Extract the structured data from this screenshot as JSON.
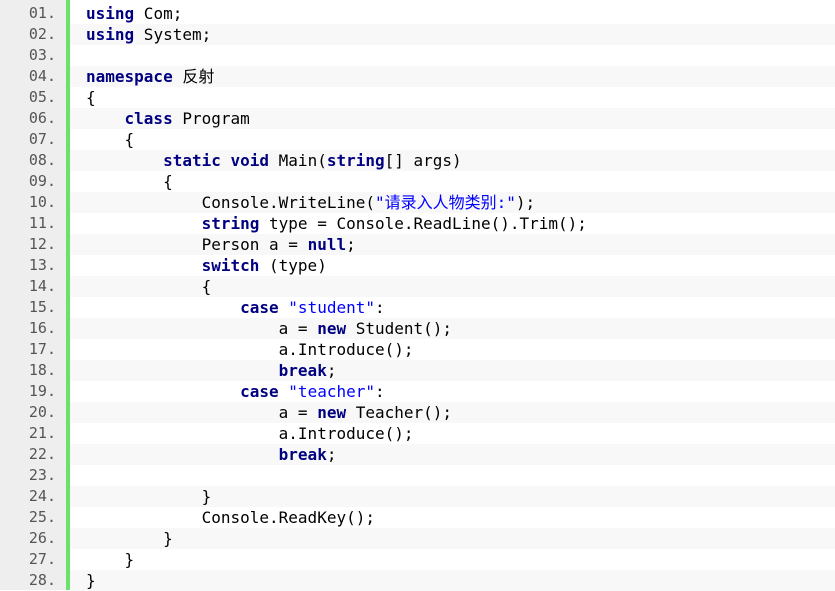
{
  "lines": [
    {
      "n": "01.",
      "tokens": [
        {
          "t": "using",
          "c": "kw"
        },
        {
          "t": " Com;"
        }
      ]
    },
    {
      "n": "02.",
      "tokens": [
        {
          "t": "using",
          "c": "kw"
        },
        {
          "t": " System;"
        }
      ]
    },
    {
      "n": "03.",
      "tokens": []
    },
    {
      "n": "04.",
      "tokens": [
        {
          "t": "namespace",
          "c": "kw"
        },
        {
          "t": " "
        },
        {
          "t": "反射",
          "c": "cjk"
        }
      ]
    },
    {
      "n": "05.",
      "tokens": [
        {
          "t": "{"
        }
      ]
    },
    {
      "n": "06.",
      "tokens": [
        {
          "t": "    "
        },
        {
          "t": "class",
          "c": "kw"
        },
        {
          "t": " Program"
        }
      ]
    },
    {
      "n": "07.",
      "tokens": [
        {
          "t": "    {"
        }
      ]
    },
    {
      "n": "08.",
      "tokens": [
        {
          "t": "        "
        },
        {
          "t": "static",
          "c": "kw"
        },
        {
          "t": " "
        },
        {
          "t": "void",
          "c": "kw"
        },
        {
          "t": " Main("
        },
        {
          "t": "string",
          "c": "kw"
        },
        {
          "t": "[] args)"
        }
      ]
    },
    {
      "n": "09.",
      "tokens": [
        {
          "t": "        {"
        }
      ]
    },
    {
      "n": "10.",
      "tokens": [
        {
          "t": "            Console.WriteLine("
        },
        {
          "t": "\"请录入人物类别:\"",
          "c": "str"
        },
        {
          "t": ");"
        }
      ]
    },
    {
      "n": "11.",
      "tokens": [
        {
          "t": "            "
        },
        {
          "t": "string",
          "c": "kw"
        },
        {
          "t": " type = Console.ReadLine().Trim();"
        }
      ]
    },
    {
      "n": "12.",
      "tokens": [
        {
          "t": "            Person a = "
        },
        {
          "t": "null",
          "c": "kw"
        },
        {
          "t": ";"
        }
      ]
    },
    {
      "n": "13.",
      "tokens": [
        {
          "t": "            "
        },
        {
          "t": "switch",
          "c": "kw"
        },
        {
          "t": " (type)"
        }
      ]
    },
    {
      "n": "14.",
      "tokens": [
        {
          "t": "            {"
        }
      ]
    },
    {
      "n": "15.",
      "tokens": [
        {
          "t": "                "
        },
        {
          "t": "case",
          "c": "kw"
        },
        {
          "t": " "
        },
        {
          "t": "\"student\"",
          "c": "str"
        },
        {
          "t": ":"
        }
      ]
    },
    {
      "n": "16.",
      "tokens": [
        {
          "t": "                    a = "
        },
        {
          "t": "new",
          "c": "kw"
        },
        {
          "t": " Student();"
        }
      ]
    },
    {
      "n": "17.",
      "tokens": [
        {
          "t": "                    a.Introduce();"
        }
      ]
    },
    {
      "n": "18.",
      "tokens": [
        {
          "t": "                    "
        },
        {
          "t": "break",
          "c": "kw"
        },
        {
          "t": ";"
        }
      ]
    },
    {
      "n": "19.",
      "tokens": [
        {
          "t": "                "
        },
        {
          "t": "case",
          "c": "kw"
        },
        {
          "t": " "
        },
        {
          "t": "\"teacher\"",
          "c": "str"
        },
        {
          "t": ":"
        }
      ]
    },
    {
      "n": "20.",
      "tokens": [
        {
          "t": "                    a = "
        },
        {
          "t": "new",
          "c": "kw"
        },
        {
          "t": " Teacher();"
        }
      ]
    },
    {
      "n": "21.",
      "tokens": [
        {
          "t": "                    a.Introduce();"
        }
      ]
    },
    {
      "n": "22.",
      "tokens": [
        {
          "t": "                    "
        },
        {
          "t": "break",
          "c": "kw"
        },
        {
          "t": ";"
        }
      ]
    },
    {
      "n": "23.",
      "tokens": []
    },
    {
      "n": "24.",
      "tokens": [
        {
          "t": "            }"
        }
      ]
    },
    {
      "n": "25.",
      "tokens": [
        {
          "t": "            Console.ReadKey();"
        }
      ]
    },
    {
      "n": "26.",
      "tokens": [
        {
          "t": "        }"
        }
      ]
    },
    {
      "n": "27.",
      "tokens": [
        {
          "t": "    }"
        }
      ]
    },
    {
      "n": "28.",
      "tokens": [
        {
          "t": "}"
        }
      ]
    }
  ]
}
